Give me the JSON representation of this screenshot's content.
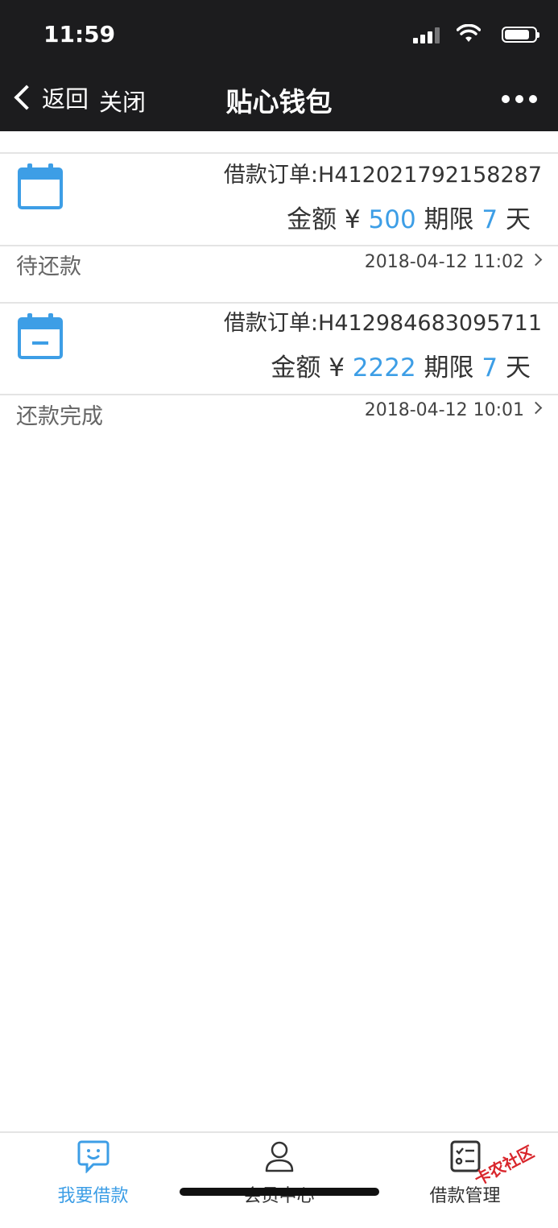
{
  "status_bar": {
    "time": "11:59"
  },
  "nav": {
    "back_label": "返回",
    "close_label": "关闭",
    "title": "贴心钱包"
  },
  "orders": [
    {
      "order_label": "借款订单:H412021792158287",
      "amount_prefix": "金额 ¥ ",
      "amount": "500",
      "term_label": " 期限 ",
      "term": "7",
      "term_unit": " 天",
      "status": "待还款",
      "datetime": "2018-04-12 11:02"
    },
    {
      "order_label": "借款订单:H412984683095711",
      "amount_prefix": "金额 ¥ ",
      "amount": "2222",
      "term_label": " 期限 ",
      "term": "7",
      "term_unit": " 天",
      "status": "还款完成",
      "datetime": "2018-04-12 10:01"
    }
  ],
  "tabbar": {
    "tabs": [
      {
        "label": "我要借款",
        "icon": "chat-smile-icon",
        "active": true
      },
      {
        "label": "会员中心",
        "icon": "user-icon",
        "active": false
      },
      {
        "label": "借款管理",
        "icon": "checklist-icon",
        "active": false
      }
    ]
  },
  "watermark": {
    "text": "卡农社区"
  },
  "colors": {
    "accent": "#3d9ee6",
    "topbar": "#1c1c1e"
  }
}
